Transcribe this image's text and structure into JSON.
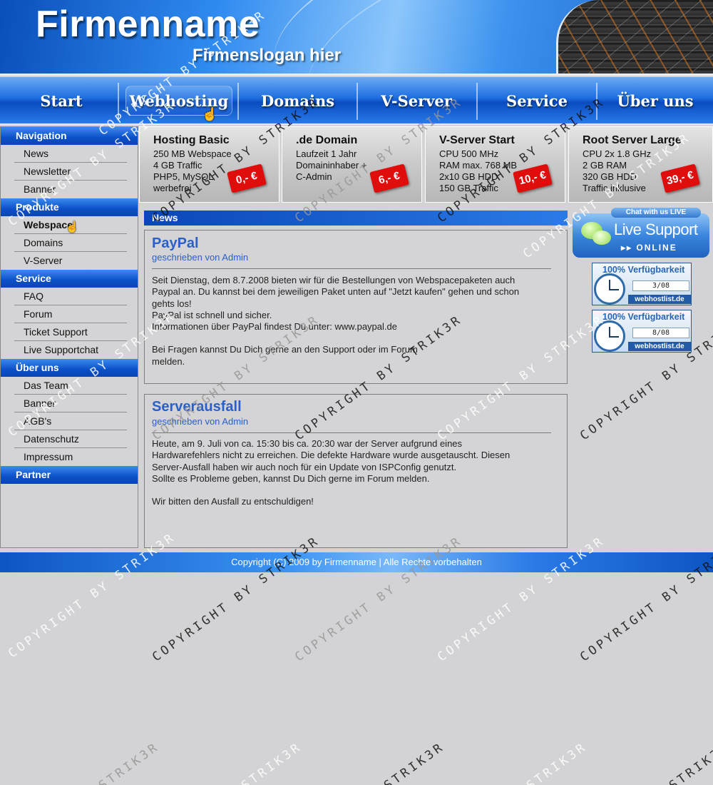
{
  "header": {
    "title": "Firmenname",
    "slogan": "Firmenslogan hier"
  },
  "mainnav": {
    "items": [
      {
        "label": "Start"
      },
      {
        "label": "Webhosting",
        "active": true
      },
      {
        "label": "Domains"
      },
      {
        "label": "V-Server"
      },
      {
        "label": "Service"
      },
      {
        "label": "Über uns"
      }
    ]
  },
  "sidebar": {
    "sections": [
      {
        "title": "Navigation",
        "items": [
          "News",
          "Newsletter",
          "Banner"
        ]
      },
      {
        "title": "Produkte",
        "items": [
          "Webspace",
          "Domains",
          "V-Server"
        ],
        "active_item": "Webspace"
      },
      {
        "title": "Service",
        "items": [
          "FAQ",
          "Forum",
          "Ticket Support",
          "Live Supportchat"
        ]
      },
      {
        "title": "Über uns",
        "items": [
          "Das Team",
          "Banner",
          "AGB's",
          "Datenschutz",
          "Impressum"
        ]
      },
      {
        "title": "Partner",
        "items": []
      }
    ]
  },
  "products": [
    {
      "title": "Hosting Basic",
      "lines": [
        "250 MB Webspace",
        "4 GB Traffic",
        "PHP5, MySQL",
        "werbefrei"
      ],
      "price": "0,- €"
    },
    {
      "title": ".de Domain",
      "lines": [
        "Laufzeit 1 Jahr",
        "Domaininhaber +",
        "C-Admin",
        ""
      ],
      "price": "6,- €"
    },
    {
      "title": "V-Server Start",
      "lines": [
        "CPU 500 MHz",
        "RAM max. 768 MB",
        "2x10 GB HDD",
        "150 GB Traffic"
      ],
      "price": "10,- €"
    },
    {
      "title": "Root Server Large",
      "lines": [
        "CPU 2x 1.8 GHz",
        "2 GB RAM",
        "320 GB HDD",
        "Traffic inklusive"
      ],
      "price": "39,- €"
    }
  ],
  "news": {
    "heading": "News",
    "posts": [
      {
        "title": "PayPal",
        "byline": "geschrieben von Admin",
        "paragraphs": [
          "Seit Dienstag, dem 8.7.2008 bieten wir für die Bestellungen von Webspacepaketen auch",
          "Paypal an. Du kannst bei dem jeweiligen Paket unten auf \"Jetzt kaufen\" gehen und schon",
          "gehts los!",
          "PayPal ist schnell und sicher.",
          "Informationen über PayPal findest Du unter: www.paypal.de",
          "",
          "Bei Fragen kannst Du Dich gerne an den Support oder im Forum",
          "melden."
        ]
      },
      {
        "title": "Serverausfall",
        "byline": "geschrieben von Admin",
        "paragraphs": [
          "Heute, am 9. Juli von ca. 15:30 bis ca. 20:30 war der Server aufgrund eines",
          "Hardwarefehlers nicht zu erreichen. Die defekte Hardware wurde ausgetauscht. Diesen",
          "Server-Ausfall haben wir auch noch für ein Update von ISPConfig genutzt.",
          "Sollte es Probleme geben, kannst Du Dich gerne im Forum melden.",
          "",
          "Wir bitten den Ausfall zu entschuldigen!"
        ]
      }
    ]
  },
  "right": {
    "livesupport": {
      "top": "Chat with us LIVE",
      "label": "Live Support",
      "status": "ONLINE"
    },
    "badges": [
      {
        "title": "100% Verfügbarkeit",
        "value": "3/08",
        "site": "webhostlist.de"
      },
      {
        "title": "100% Verfügbarkeit",
        "value": "8/08",
        "site": "webhostlist.de"
      }
    ]
  },
  "footer": {
    "text": "Copyright (C) 2009 by Firmenname | Alle Rechte vorbehalten"
  },
  "watermark": {
    "text": "COPYRIGHT BY STRIK3R",
    "text_short": "STRIK3R"
  },
  "colors": {
    "brand_blue": "#0b4fc6",
    "link_blue": "#2b60c8",
    "price_red": "#e00d0d",
    "background": "#d3d2d4"
  }
}
